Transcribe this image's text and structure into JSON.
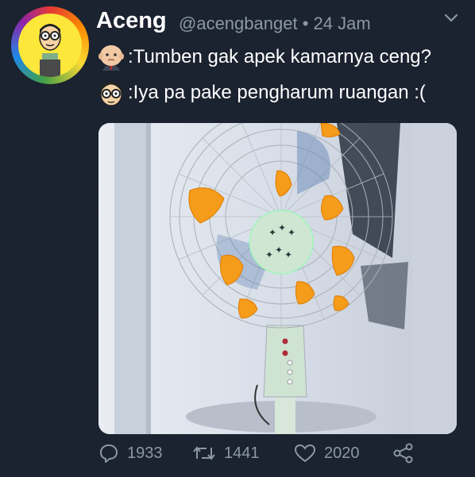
{
  "tweet": {
    "display_name": "Aceng",
    "handle": "@acengbanget",
    "separator": "•",
    "time": "24 Jam",
    "lines": [
      ":Tumben gak apek kamarnya ceng?",
      ":Iya pa pake pengharum ruangan :("
    ]
  },
  "actions": {
    "reply_count": "1933",
    "retweet_count": "1441",
    "like_count": "2020"
  },
  "icons": [
    "avatar",
    "chevron-down-icon",
    "baby-boss-emoji",
    "aceng-emoji",
    "reply-icon",
    "retweet-icon",
    "heart-icon",
    "share-icon"
  ],
  "colors": {
    "background": "#1b2230",
    "secondary_text": "#8b98a5"
  }
}
